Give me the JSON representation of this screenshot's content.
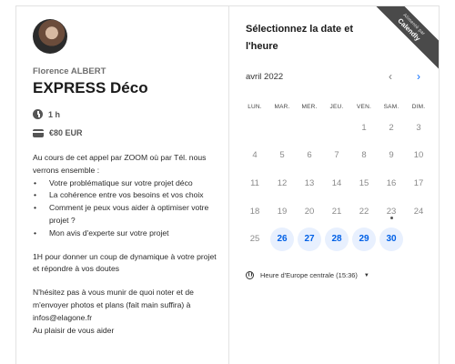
{
  "host": {
    "name": "Florence ALBERT"
  },
  "event": {
    "title": "EXPRESS Déco",
    "duration": "1 h",
    "price": "€80 EUR"
  },
  "description": {
    "intro": "Au cours de cet appel par ZOOM où par Tél. nous verrons ensemble :",
    "bullets": [
      "Votre problématique sur votre projet déco",
      "La cohérence entre vos besoins et vos choix",
      "Comment je peux vous aider à optimiser votre projet ?",
      "Mon avis d'experte sur votre projet"
    ],
    "para2": "1H pour donner un coup de dynamique à votre projet et répondre à vos doutes",
    "para3": "N'hésitez pas à vous munir de quoi noter et de m'envoyer photos et plans (fait main suffira) à infos@elagone.fr",
    "para4": "Au plaisir de vous aider"
  },
  "calendar": {
    "heading": "Sélectionnez la date et l'heure",
    "month": "avril 2022",
    "prev_icon": "‹",
    "next_icon": "›",
    "weekdays": [
      "LUN.",
      "MAR.",
      "MER.",
      "JEU.",
      "VEN.",
      "SAM.",
      "DIM."
    ],
    "leading_blanks": 4,
    "days": [
      {
        "d": "1",
        "available": false
      },
      {
        "d": "2",
        "available": false
      },
      {
        "d": "3",
        "available": false
      },
      {
        "d": "4",
        "available": false
      },
      {
        "d": "5",
        "available": false
      },
      {
        "d": "6",
        "available": false
      },
      {
        "d": "7",
        "available": false
      },
      {
        "d": "8",
        "available": false
      },
      {
        "d": "9",
        "available": false
      },
      {
        "d": "10",
        "available": false
      },
      {
        "d": "11",
        "available": false
      },
      {
        "d": "12",
        "available": false
      },
      {
        "d": "13",
        "available": false
      },
      {
        "d": "14",
        "available": false
      },
      {
        "d": "15",
        "available": false
      },
      {
        "d": "16",
        "available": false
      },
      {
        "d": "17",
        "available": false
      },
      {
        "d": "18",
        "available": false
      },
      {
        "d": "19",
        "available": false
      },
      {
        "d": "20",
        "available": false
      },
      {
        "d": "21",
        "available": false
      },
      {
        "d": "22",
        "available": false
      },
      {
        "d": "23",
        "available": false,
        "today": true
      },
      {
        "d": "24",
        "available": false
      },
      {
        "d": "25",
        "available": false
      },
      {
        "d": "26",
        "available": true
      },
      {
        "d": "27",
        "available": true
      },
      {
        "d": "28",
        "available": true
      },
      {
        "d": "29",
        "available": true
      },
      {
        "d": "30",
        "available": true
      }
    ],
    "timezone": "Heure d'Europe centrale (15:36)"
  },
  "badge": {
    "line1": "Alimenté par",
    "line2": "Calendly"
  },
  "colors": {
    "accent": "#0069ff",
    "available_bg": "#e8f0fe"
  }
}
